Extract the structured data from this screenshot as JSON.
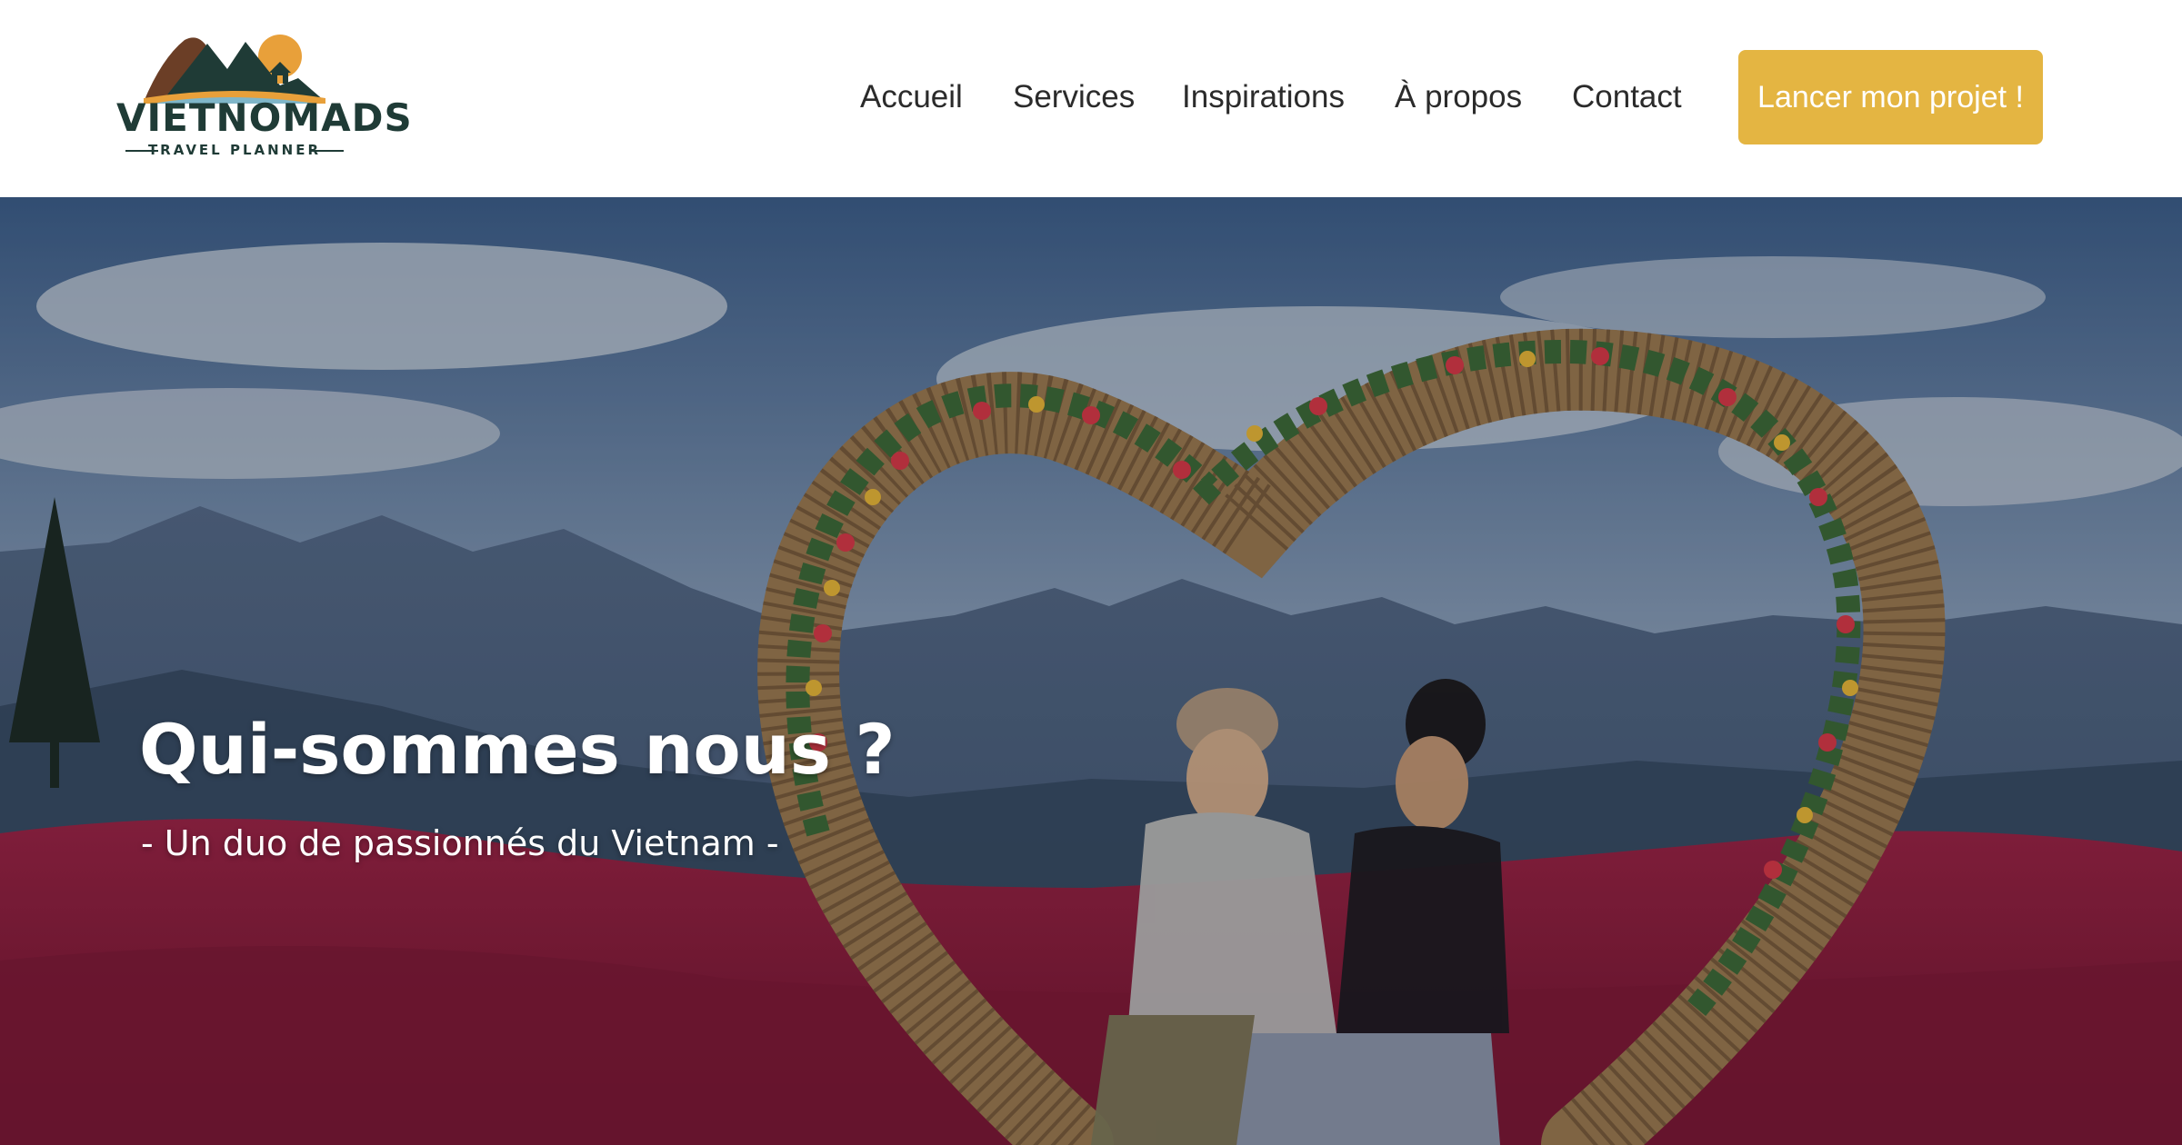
{
  "brand": {
    "name": "VIETNOMADS",
    "tagline": "TRAVEL PLANNER"
  },
  "nav": {
    "items": [
      {
        "label": "Accueil"
      },
      {
        "label": "Services"
      },
      {
        "label": "Inspirations"
      },
      {
        "label": "À propos"
      },
      {
        "label": "Contact"
      }
    ],
    "cta_label": "Lancer mon projet !"
  },
  "hero": {
    "title": "Qui-sommes nous ?",
    "subtitle": "- Un duo de passionnés du Vietnam -"
  },
  "colors": {
    "accent": "#e4b542",
    "brand_dark": "#1f3b36",
    "logo_orange": "#e8a03a",
    "logo_brown": "#6b3e26",
    "nav_text": "#2b2b2b"
  }
}
